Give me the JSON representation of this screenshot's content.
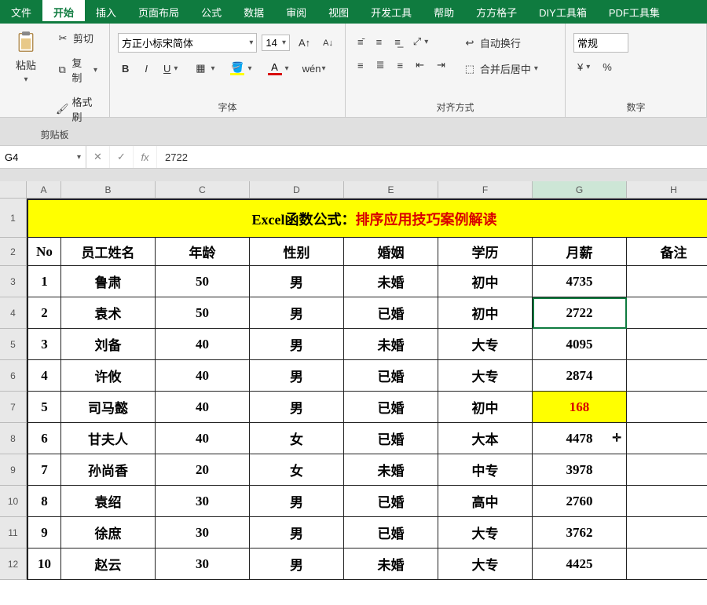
{
  "menu": {
    "items": [
      "文件",
      "开始",
      "插入",
      "页面布局",
      "公式",
      "数据",
      "审阅",
      "视图",
      "开发工具",
      "帮助",
      "方方格子",
      "DIY工具箱",
      "PDF工具集"
    ],
    "active": "开始"
  },
  "ribbon": {
    "clipboard": {
      "paste": "粘贴",
      "cut": "剪切",
      "copy": "复制",
      "format_painter": "格式刷",
      "label": "剪贴板"
    },
    "font": {
      "name": "方正小标宋简体",
      "size": "14",
      "bold": "B",
      "italic": "I",
      "underline": "U",
      "label": "字体"
    },
    "alignment": {
      "wrap": "自动换行",
      "merge": "合并后居中",
      "label": "对齐方式"
    },
    "number": {
      "general": "常规",
      "label": "数字"
    }
  },
  "formulabar": {
    "namebox": "G4",
    "value": "2722"
  },
  "columns": [
    "A",
    "B",
    "C",
    "D",
    "E",
    "F",
    "G",
    "H"
  ],
  "title": {
    "prefix": "Excel函数公式：",
    "suffix": "排序应用技巧案例解读"
  },
  "headers": [
    "No",
    "员工姓名",
    "年龄",
    "性别",
    "婚姻",
    "学历",
    "月薪",
    "备注"
  ],
  "rows": [
    {
      "no": "1",
      "name": "鲁肃",
      "age": "50",
      "gender": "男",
      "marriage": "未婚",
      "edu": "初中",
      "salary": "4735",
      "note": ""
    },
    {
      "no": "2",
      "name": "袁术",
      "age": "50",
      "gender": "男",
      "marriage": "已婚",
      "edu": "初中",
      "salary": "2722",
      "note": "",
      "selected": true
    },
    {
      "no": "3",
      "name": "刘备",
      "age": "40",
      "gender": "男",
      "marriage": "未婚",
      "edu": "大专",
      "salary": "4095",
      "note": ""
    },
    {
      "no": "4",
      "name": "许攸",
      "age": "40",
      "gender": "男",
      "marriage": "已婚",
      "edu": "大专",
      "salary": "2874",
      "note": ""
    },
    {
      "no": "5",
      "name": "司马懿",
      "age": "40",
      "gender": "男",
      "marriage": "已婚",
      "edu": "初中",
      "salary": "168",
      "note": "",
      "highlight": true
    },
    {
      "no": "6",
      "name": "甘夫人",
      "age": "40",
      "gender": "女",
      "marriage": "已婚",
      "edu": "大本",
      "salary": "4478",
      "note": "",
      "cursor": true
    },
    {
      "no": "7",
      "name": "孙尚香",
      "age": "20",
      "gender": "女",
      "marriage": "未婚",
      "edu": "中专",
      "salary": "3978",
      "note": ""
    },
    {
      "no": "8",
      "name": "袁绍",
      "age": "30",
      "gender": "男",
      "marriage": "已婚",
      "edu": "高中",
      "salary": "2760",
      "note": ""
    },
    {
      "no": "9",
      "name": "徐庶",
      "age": "30",
      "gender": "男",
      "marriage": "已婚",
      "edu": "大专",
      "salary": "3762",
      "note": ""
    },
    {
      "no": "10",
      "name": "赵云",
      "age": "30",
      "gender": "男",
      "marriage": "未婚",
      "edu": "大专",
      "salary": "4425",
      "note": ""
    }
  ],
  "selected_column": "G"
}
